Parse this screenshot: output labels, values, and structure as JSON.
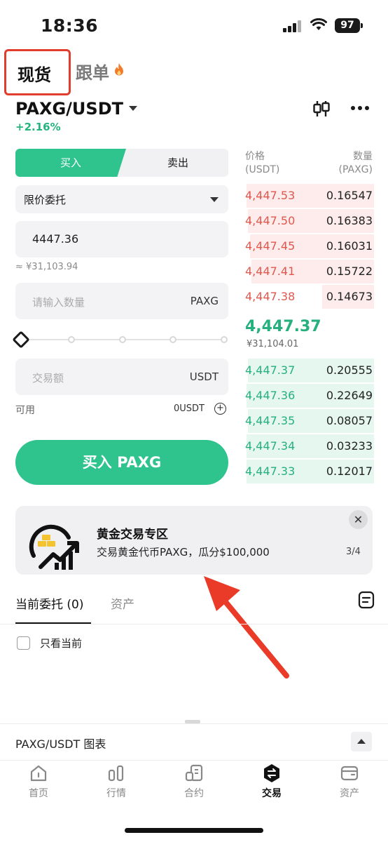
{
  "status_bar": {
    "time": "18:36",
    "battery": "97"
  },
  "top_tabs": {
    "spot": "现货",
    "copy": "跟单"
  },
  "pair": {
    "name": "PAXG/USDT",
    "change": "+2.16%"
  },
  "form": {
    "buy_tab": "买入",
    "sell_tab": "卖出",
    "order_type": "限价委托",
    "price": "4447.36",
    "approx": "≈ ¥31,103.94",
    "qty_placeholder": "请输入数量",
    "qty_unit": "PAXG",
    "amount_placeholder": "交易额",
    "amount_unit": "USDT",
    "available_label": "可用",
    "available_value": "0USDT",
    "slider_value": 0,
    "buy_button": "买入 PAXG"
  },
  "orderbook": {
    "price_header": "价格",
    "price_unit": "(USDT)",
    "qty_header": "数量",
    "qty_unit": "(PAXG)",
    "asks": [
      {
        "price": "4,447.53",
        "qty": "0.16547",
        "depth": 0.98
      },
      {
        "price": "4,447.50",
        "qty": "0.16383",
        "depth": 0.97
      },
      {
        "price": "4,447.45",
        "qty": "0.16031",
        "depth": 0.95
      },
      {
        "price": "4,447.41",
        "qty": "0.15722",
        "depth": 0.94
      },
      {
        "price": "4,447.38",
        "qty": "0.14673",
        "depth": 0.4
      }
    ],
    "last_price": "4,447.37",
    "last_fiat": "¥31,104.01",
    "bids": [
      {
        "price": "4,447.37",
        "qty": "0.20555",
        "depth": 0.97
      },
      {
        "price": "4,447.36",
        "qty": "0.22649",
        "depth": 0.98
      },
      {
        "price": "4,447.35",
        "qty": "0.08057",
        "depth": 0.97
      },
      {
        "price": "4,447.34",
        "qty": "0.03233",
        "depth": 0.98
      },
      {
        "price": "4,447.33",
        "qty": "0.12017",
        "depth": 0.98
      }
    ]
  },
  "banner": {
    "title": "黄金交易专区",
    "subtitle": "交易黄金代币PAXG，瓜分$100,000",
    "page": "3/4",
    "close": "✕"
  },
  "orders": {
    "tab_open": "当前委托 (0)",
    "tab_assets": "资产",
    "only_current": "只看当前"
  },
  "chart_bar": {
    "label": "PAXG/USDT 图表"
  },
  "nav": {
    "items": [
      {
        "label": "首页",
        "icon": "home-icon"
      },
      {
        "label": "行情",
        "icon": "market-icon"
      },
      {
        "label": "合约",
        "icon": "futures-icon"
      },
      {
        "label": "交易",
        "icon": "trade-icon"
      },
      {
        "label": "资产",
        "icon": "wallet-icon"
      }
    ],
    "active": "交易"
  },
  "colors": {
    "green": "#2fc38d",
    "red": "#e0574d",
    "highlight_box": "#e23d2c"
  }
}
